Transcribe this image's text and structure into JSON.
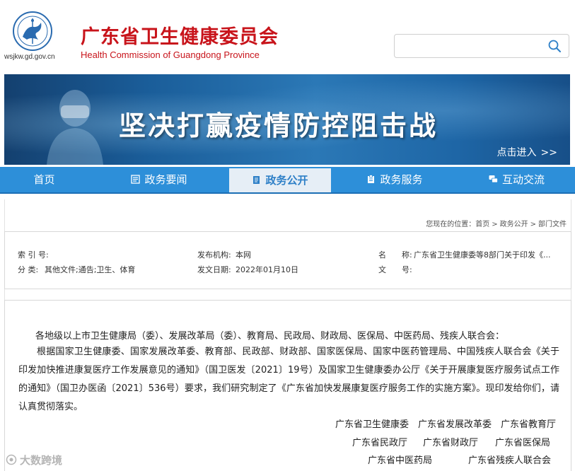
{
  "header": {
    "domain": "wsjkw.gd.gov.cn",
    "title": "广东省卫生健康委员会",
    "subtitle": "Health Commission of Guangdong Province",
    "search_placeholder": ""
  },
  "banner": {
    "title": "坚决打赢疫情防控阻击战",
    "link_label": "点击进入",
    "link_arrow": ">>"
  },
  "nav": {
    "items": [
      {
        "label": "首页",
        "icon": "",
        "active": false
      },
      {
        "label": "政务要闻",
        "icon": "news-icon",
        "active": false
      },
      {
        "label": "政务公开",
        "icon": "document-icon",
        "active": true
      },
      {
        "label": "政务服务",
        "icon": "clipboard-icon",
        "active": false
      },
      {
        "label": "互动交流",
        "icon": "chat-icon",
        "active": false
      }
    ]
  },
  "breadcrumb": {
    "prefix": "您现在的位置：",
    "items": [
      "首页",
      "政务公开",
      "部门文件"
    ],
    "sep": ">"
  },
  "info": {
    "index_label": "索 引 号:",
    "index_value": "",
    "category_label": "分 类:",
    "category_value": "其他文件;通告;卫生、体育",
    "publisher_label": "发布机构:",
    "publisher_value": "本网",
    "date_label": "发文日期:",
    "date_value": "2022年01月10日",
    "name_label": "名　　称:",
    "name_value": "广东省卫生健康委等8部门关于印发《...",
    "docno_label": "文　　号:",
    "docno_value": ""
  },
  "body": {
    "salutation": "各地级以上市卫生健康局（委）、发展改革局（委）、教育局、民政局、财政局、医保局、中医药局、残疾人联合会：",
    "main": "根据国家卫生健康委、国家发展改革委、教育部、民政部、财政部、国家医保局、国家中医药管理局、中国残疾人联合会《关于印发加快推进康复医疗工作发展意见的通知》（国卫医发〔2021〕19号）及国家卫生健康委办公厅《关于开展康复医疗服务试点工作的通知》（国卫办医函〔2021〕536号）要求，我们研究制定了《广东省加快发展康复医疗服务工作的实施方案》。现印发给你们，请认真贯彻落实。",
    "signatories": [
      [
        "广东省卫生健康委",
        "广东省发展改革委",
        "广东省教育厅"
      ],
      [
        "广东省民政厅",
        "广东省财政厅",
        "广东省医保局"
      ],
      [
        "广东省中医药局",
        "广东省残疾人联合会"
      ]
    ]
  },
  "watermark": "大数跨境",
  "colors": {
    "brand_red": "#c8141b",
    "nav_blue": "#2d8fd9",
    "active_tab_bg": "#e6eef6"
  }
}
